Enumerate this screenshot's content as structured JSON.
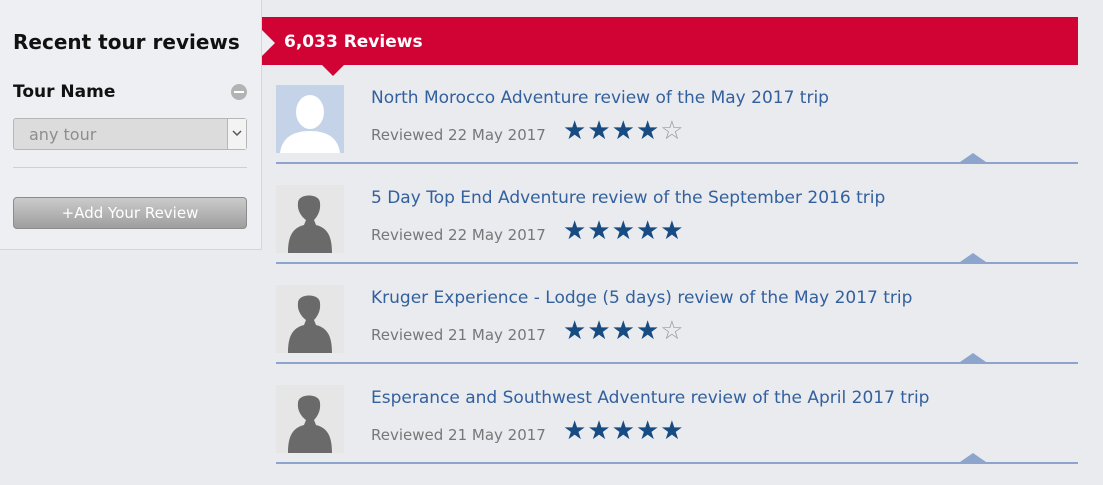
{
  "sidebar": {
    "title": "Recent tour reviews",
    "filter_label": "Tour Name",
    "tour_select": {
      "value": "any tour"
    },
    "add_review_label": "+Add Your Review"
  },
  "banner": {
    "count_label": "6,033 Reviews"
  },
  "colors": {
    "banner_red": "#d10234",
    "link_blue": "#33609e",
    "star_blue": "#174b82",
    "divider_blue": "#8da5cc"
  },
  "reviews": [
    {
      "title": "North Morocco Adventure review of the May 2017 trip",
      "date": "Reviewed 22 May 2017",
      "rating": 4,
      "avatar": "default-avatar-icon"
    },
    {
      "title": "5 Day Top End Adventure review of the September 2016 trip",
      "date": "Reviewed 22 May 2017",
      "rating": 5,
      "avatar": "female-avatar-icon"
    },
    {
      "title": "Kruger Experience - Lodge (5 days) review of the May 2017 trip",
      "date": "Reviewed 21 May 2017",
      "rating": 4,
      "avatar": "female-avatar-icon"
    },
    {
      "title": "Esperance and Southwest Adventure review of the April 2017 trip",
      "date": "Reviewed 21 May 2017",
      "rating": 5,
      "avatar": "female-avatar-icon"
    }
  ]
}
